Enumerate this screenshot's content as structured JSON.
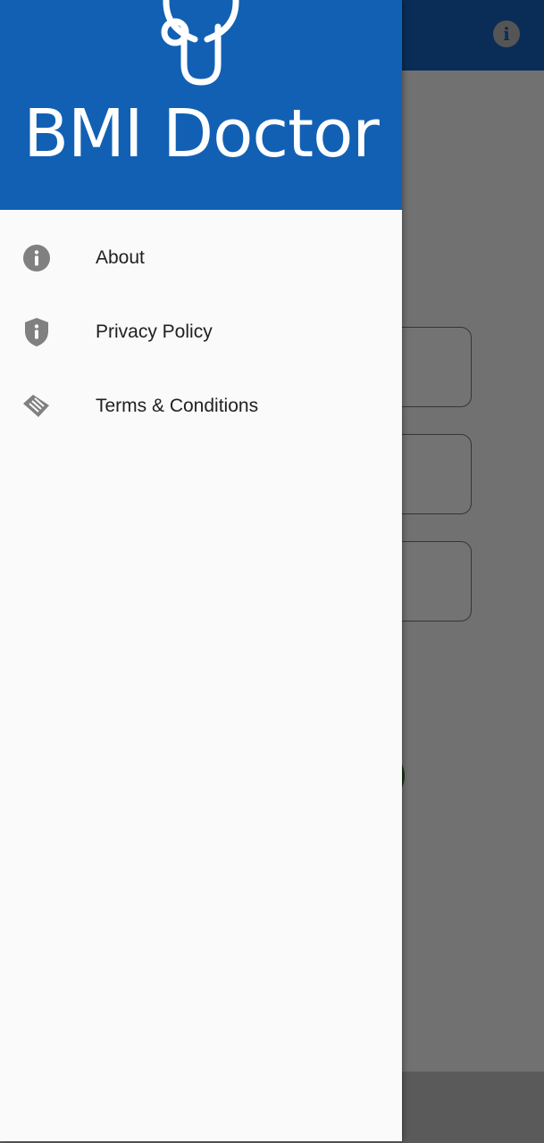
{
  "app": {
    "brand_color": "#1565c0",
    "info_icon": "info-icon"
  },
  "drawer": {
    "header": {
      "logo_text": "BMI Doctor",
      "logo_icon": "stethoscope-icon",
      "background": "#1260b4"
    },
    "items": [
      {
        "label": "About",
        "icon": "info-icon"
      },
      {
        "label": "Privacy Policy",
        "icon": "shield-icon"
      },
      {
        "label": "Terms & Conditions",
        "icon": "handshake-icon"
      }
    ]
  }
}
